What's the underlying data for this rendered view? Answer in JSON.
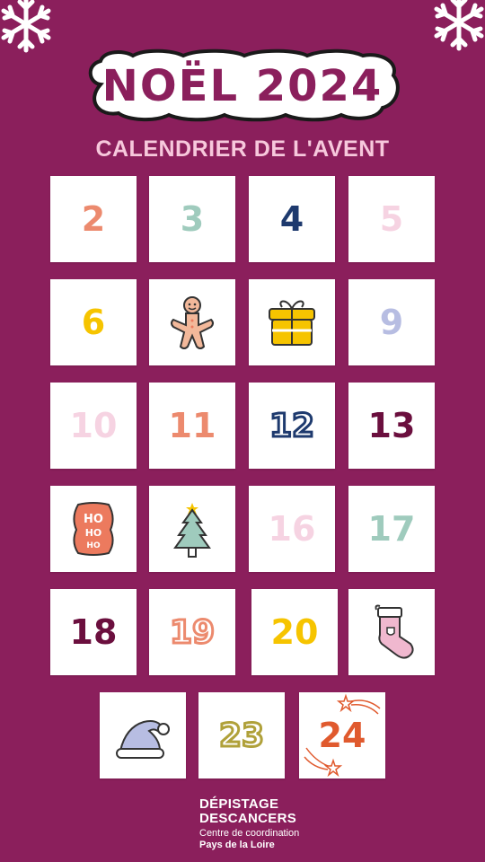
{
  "header": {
    "title": "NOËL 2024",
    "subtitle": "CALENDRIER DE L'AVENT"
  },
  "tiles": [
    {
      "label": "2",
      "color": "#ec8a6e"
    },
    {
      "label": "3",
      "color": "#9fcbbd"
    },
    {
      "label": "4",
      "color": "#1e3a6e"
    },
    {
      "label": "5",
      "color": "#f6d3e2"
    },
    {
      "label": "6",
      "color": "#f6c400"
    },
    {
      "label": "",
      "icon": "gingerbread-man-icon"
    },
    {
      "label": "",
      "icon": "gift-box-icon"
    },
    {
      "label": "9",
      "color": "#b7bde2"
    },
    {
      "label": "10",
      "color": "#f6d3e2"
    },
    {
      "label": "11",
      "color": "#ec8a6e"
    },
    {
      "label": "12",
      "color": "#1e3a6e"
    },
    {
      "label": "13",
      "color": "#6b0f3e"
    },
    {
      "label": "HO HO HO",
      "icon": "hohoho-sticker-icon",
      "color": "#ec7a5e"
    },
    {
      "label": "",
      "icon": "christmas-tree-icon"
    },
    {
      "label": "16",
      "color": "#f6d3e2"
    },
    {
      "label": "17",
      "color": "#9fcbbd"
    },
    {
      "label": "18",
      "color": "#6b0f3e"
    },
    {
      "label": "19",
      "color": "#ec8a6e"
    },
    {
      "label": "20",
      "color": "#f6c400"
    },
    {
      "label": "",
      "icon": "christmas-stocking-icon"
    },
    {
      "label": "",
      "icon": "santa-hat-icon"
    },
    {
      "label": "23",
      "color": "#b0a13a"
    },
    {
      "label": "24",
      "color": "#e05a2e"
    }
  ],
  "footer": {
    "line1": "DÉPISTAGE",
    "line2": "DESCANCERS",
    "line3": "Centre de coordination",
    "line4": "Pays de la Loire"
  },
  "colors": {
    "background": "#8b1f5c",
    "title": "#8b1f5c",
    "subtitle": "#f7c8dc",
    "tile": "#ffffff"
  }
}
